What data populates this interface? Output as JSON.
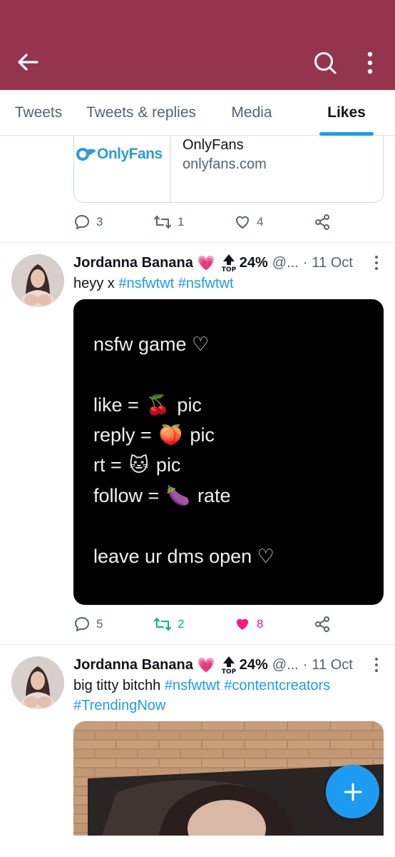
{
  "header": {
    "back_icon": "arrow-left-icon",
    "search_icon": "search-icon",
    "more_icon": "more-vertical-icon",
    "background": "#95354d"
  },
  "tabs": [
    {
      "label": "Tweets",
      "active": false
    },
    {
      "label": "Tweets & replies",
      "active": false
    },
    {
      "label": "Media",
      "active": false
    },
    {
      "label": "Likes",
      "active": true
    }
  ],
  "link_card": {
    "logo_text": "OnlyFans",
    "title": "OnlyFans",
    "domain": "onlyfans.com"
  },
  "tweet0_actions": {
    "replies": "3",
    "retweets": "1",
    "likes": "4"
  },
  "tweets": [
    {
      "name": "Jordanna Banana",
      "badge_emoji": "💗",
      "rank_pct": "24%",
      "handle": "@...",
      "date": "11 Oct",
      "text_plain": "heyy x",
      "hashtags": [
        "#nsfwtwt",
        "#nsfwtwt"
      ],
      "media": {
        "line1": "nsfw game ♡",
        "line2_a": "like =",
        "line2_emoji": "🍒",
        "line2_b": "pic",
        "line3_a": "reply =",
        "line3_emoji": "🍑",
        "line3_b": "pic",
        "line4_a": "rt =",
        "line4_emoji": "🐱",
        "line4_b": "pic",
        "line5_a": "follow =",
        "line5_emoji": "🍆",
        "line5_b": "rate",
        "line6": "leave ur dms open ♡"
      },
      "actions": {
        "replies": "5",
        "retweets": "2",
        "likes": "8"
      }
    },
    {
      "name": "Jordanna Banana",
      "badge_emoji": "💗",
      "rank_pct": "24%",
      "handle": "@...",
      "date": "11 Oct",
      "text_plain": "big titty bitchh",
      "hashtags": [
        "#nsfwtwt",
        "#contentcreators",
        "#TrendingNow"
      ]
    }
  ],
  "colors": {
    "accent": "#1d9bf0",
    "retweet_active": "#00ba7c",
    "like_active": "#f91880",
    "muted": "#536471"
  },
  "fab": {
    "icon": "plus-icon"
  }
}
